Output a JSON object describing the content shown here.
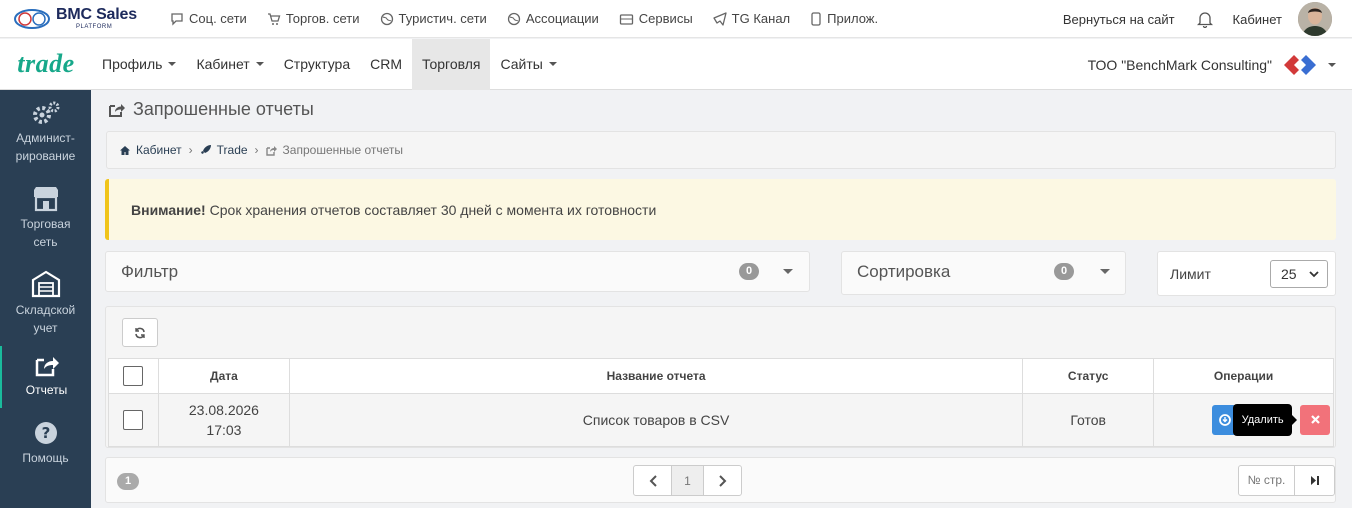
{
  "header": {
    "logo_text": "BMC Sales",
    "logo_subtitle": "PLATFORM",
    "logo_badge": "BMC",
    "nav": [
      {
        "label": "Соц. сети",
        "icon": "chat-icon"
      },
      {
        "label": "Торгов. сети",
        "icon": "cart-icon"
      },
      {
        "label": "Туристич. сети",
        "icon": "globe-icon"
      },
      {
        "label": "Ассоциации",
        "icon": "globe-icon"
      },
      {
        "label": "Сервисы",
        "icon": "box-icon"
      },
      {
        "label": "TG Канал",
        "icon": "telegram-icon"
      },
      {
        "label": "Прилож.",
        "icon": "phone-icon"
      }
    ],
    "back_to_site": "Вернуться на сайт",
    "cabinet": "Кабинет"
  },
  "navbar": {
    "brand": "trade",
    "menu": [
      {
        "label": "Профиль",
        "dropdown": true,
        "active": false
      },
      {
        "label": "Кабинет",
        "dropdown": true,
        "active": false
      },
      {
        "label": "Структура",
        "dropdown": false,
        "active": false
      },
      {
        "label": "CRM",
        "dropdown": false,
        "active": false
      },
      {
        "label": "Торговля",
        "dropdown": false,
        "active": true
      },
      {
        "label": "Сайты",
        "dropdown": true,
        "active": false
      }
    ],
    "company": "ТОО \"BenchMark Consulting\""
  },
  "sidebar": {
    "items": [
      {
        "label1": "Админист-",
        "label2": "рирование",
        "icon": "gears-icon"
      },
      {
        "label1": "Торговая",
        "label2": "сеть",
        "icon": "store-icon"
      },
      {
        "label1": "Складской",
        "label2": "учет",
        "icon": "warehouse-icon"
      },
      {
        "label1": "Отчеты",
        "label2": "",
        "icon": "share-icon",
        "active": true
      },
      {
        "label1": "Помощь",
        "label2": "",
        "icon": "help-icon"
      }
    ]
  },
  "page": {
    "title": "Запрошенные отчеты",
    "breadcrumb": [
      "Кабинет",
      "Trade",
      "Запрошенные отчеты"
    ],
    "alert_bold": "Внимание!",
    "alert_text": "Срок хранения отчетов составляет 30 дней с момента их готовности",
    "filter": {
      "label": "Фильтр",
      "count": "0"
    },
    "sort": {
      "label": "Сортировка",
      "count": "0"
    },
    "limit": {
      "label": "Лимит",
      "value": "25"
    }
  },
  "table": {
    "headers": {
      "date": "Дата",
      "name": "Название отчета",
      "status": "Статус",
      "ops": "Операции"
    },
    "rows": [
      {
        "date_line1": "23.08.2026",
        "date_line2": "17:03",
        "name": "Список товаров в CSV",
        "status": "Готов"
      }
    ],
    "tooltip": "Удалить"
  },
  "pager": {
    "pages": "1",
    "current": "1",
    "page_input_placeholder": "№ стр."
  },
  "colors": {
    "accent": "#1abb9c",
    "sidebar": "#2a3f54",
    "primary": "#3c8dde",
    "danger": "#f2727a",
    "warning": "#f0c419"
  }
}
